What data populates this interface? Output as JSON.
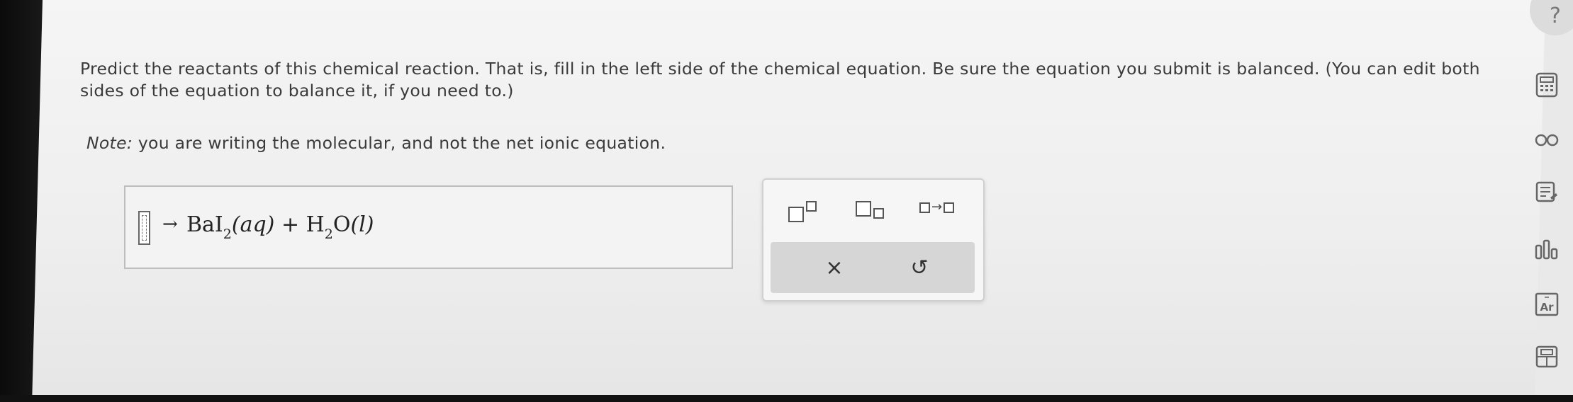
{
  "question": {
    "prompt": "Predict the reactants of this chemical reaction. That is, fill in the left side of the chemical equation. Be sure the equation you submit is balanced. (You can edit both sides of the equation to balance it, if you need to.)",
    "note_label": "Note:",
    "note_text": "you are writing the molecular, and not the net ionic equation."
  },
  "equation": {
    "arrow": "→",
    "product1_base": "BaI",
    "product1_sub": "2",
    "product1_state": "(aq)",
    "plus": "+",
    "product2_base": "H",
    "product2_sub": "2",
    "product2_tail": "O",
    "product2_state": "(l)"
  },
  "toolbox": {
    "arrow_glyph": "→",
    "clear_glyph": "×",
    "undo_glyph": "↺"
  },
  "sidebar": {
    "help_glyph": "?",
    "items": [
      "calculator-icon",
      "glasses-icon",
      "notes-icon",
      "chart-icon",
      "periodic-table-icon",
      "data-icon"
    ]
  }
}
